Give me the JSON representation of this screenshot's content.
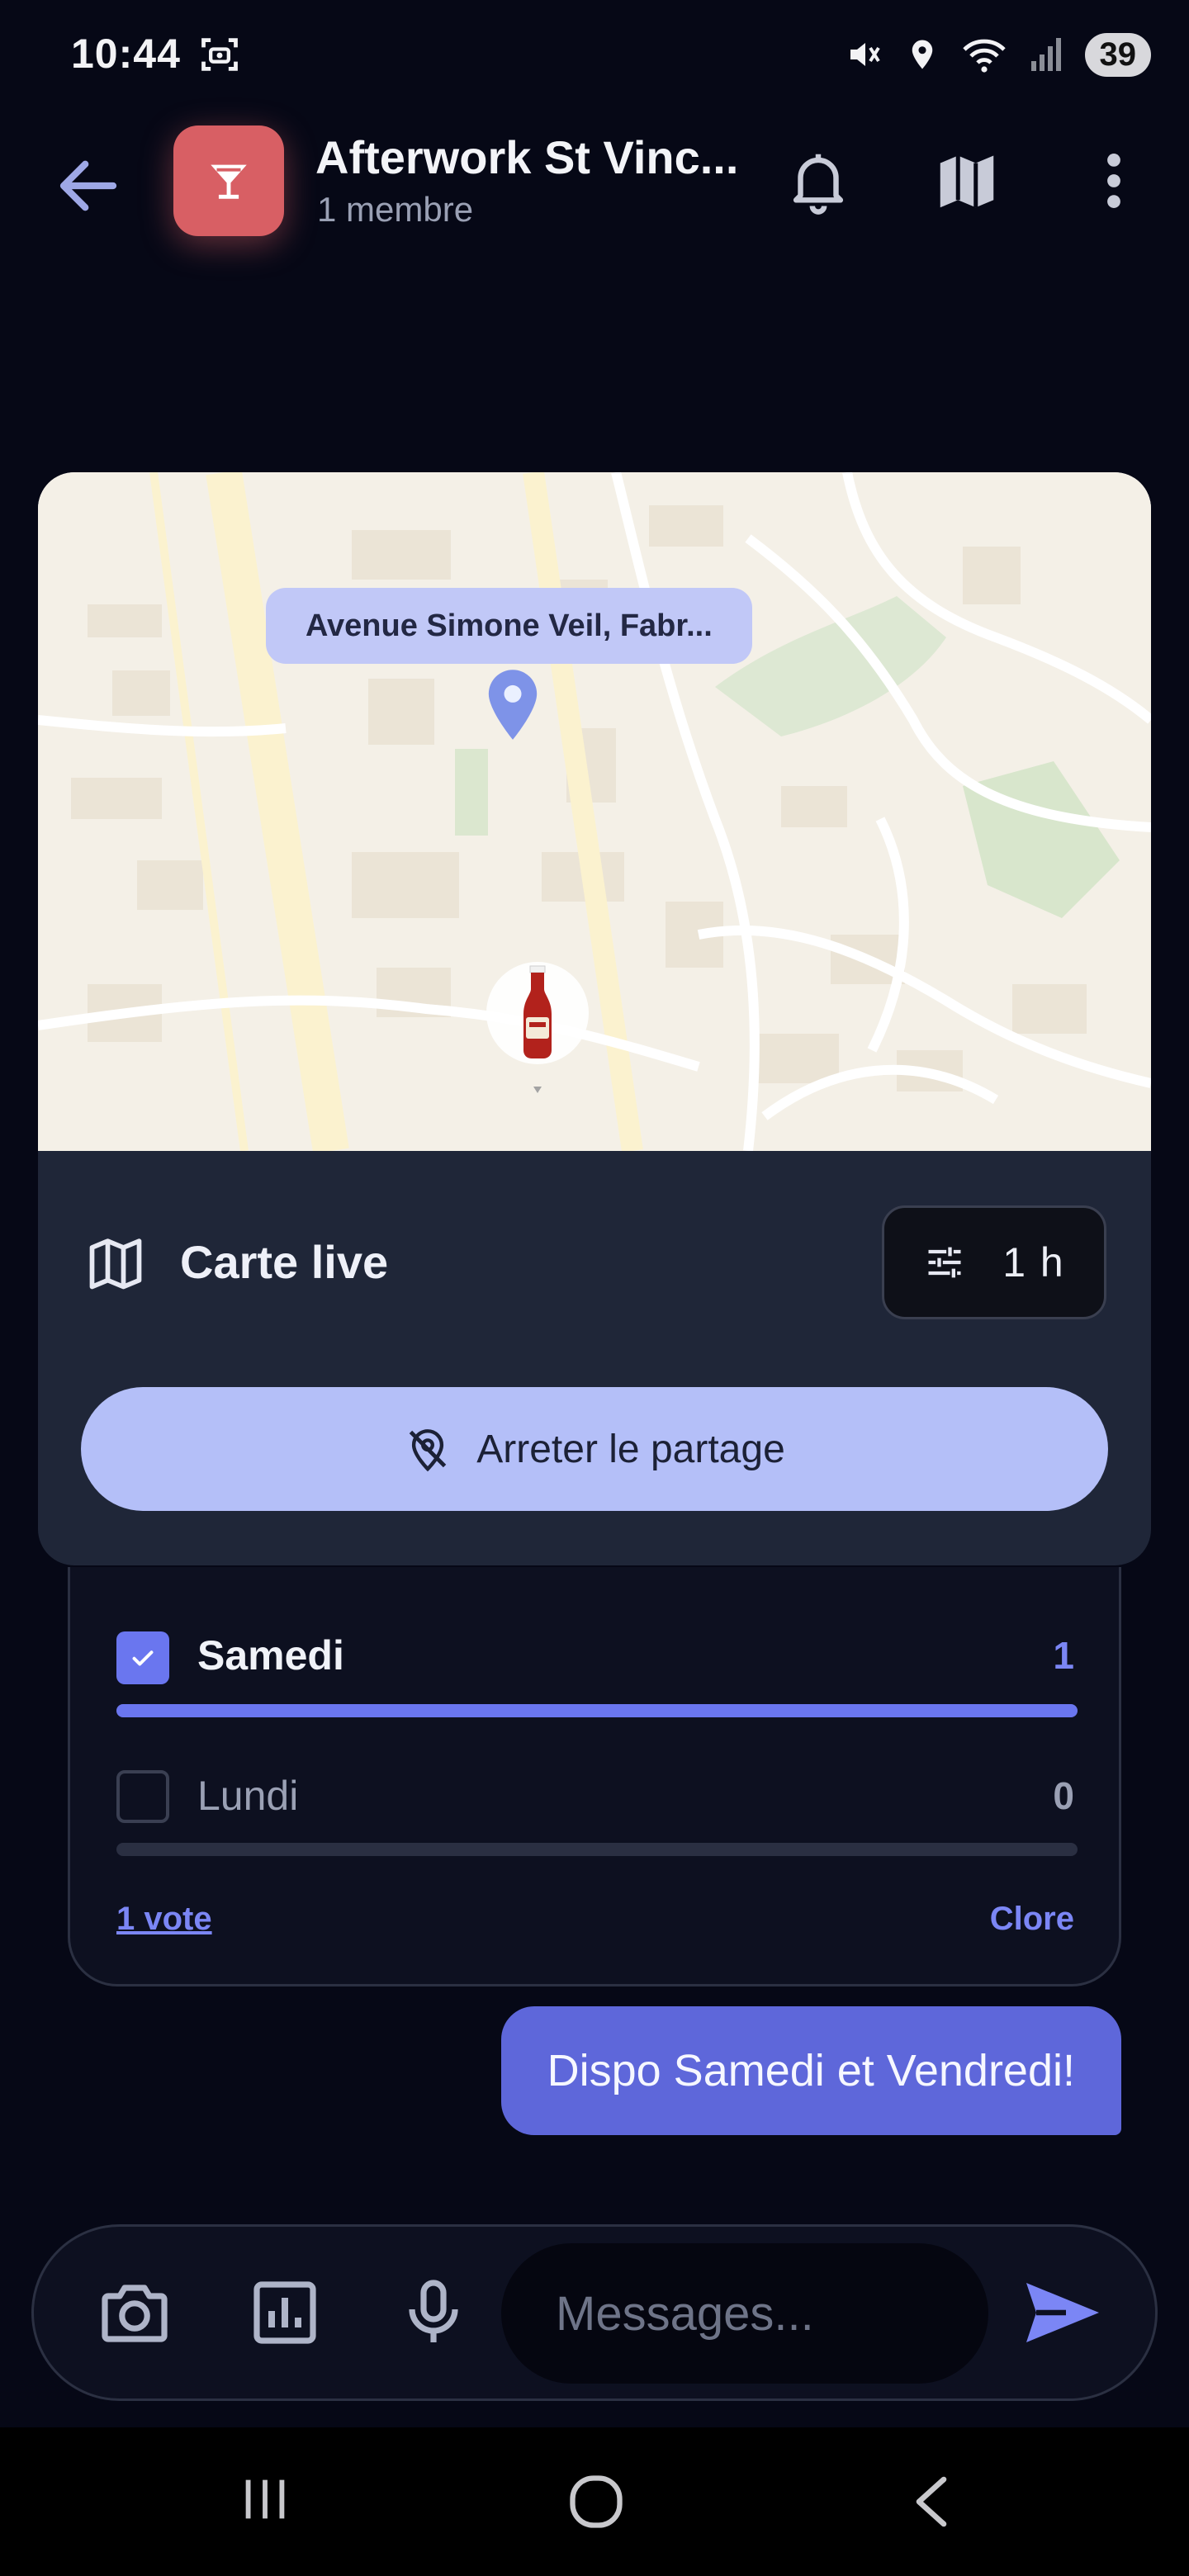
{
  "status_bar": {
    "time": "10:44",
    "battery": "39",
    "icons": [
      "screenshot-icon",
      "mute-icon",
      "location-icon",
      "wifi-icon",
      "signal-icon"
    ]
  },
  "header": {
    "title": "Afterwork St Vinc...",
    "subtitle": "1 membre",
    "avatar_icon": "cocktail-icon",
    "avatar_color": "#d85f64",
    "actions": [
      "bell-icon",
      "map-icon",
      "more-vert-icon"
    ]
  },
  "live_map": {
    "location_label": "Avenue Simone Veil, Fabr...",
    "title": "Carte live",
    "duration": "1 h",
    "stop_button": "Arreter le partage"
  },
  "poll": {
    "options": [
      {
        "label": "Samedi",
        "votes": "1",
        "checked": true,
        "fraction": 1.0
      },
      {
        "label": "Lundi",
        "votes": "0",
        "checked": false,
        "fraction": 0.0
      }
    ],
    "votes_link": "1 vote",
    "close_label": "Clore"
  },
  "message": {
    "text": "Dispo Samedi et Vendredi!"
  },
  "composer": {
    "placeholder": "Messages..."
  },
  "colors": {
    "background": "#060816",
    "accent": "#6a76ef",
    "bubble": "#5e67da",
    "stop_button": "#b4bff8"
  }
}
